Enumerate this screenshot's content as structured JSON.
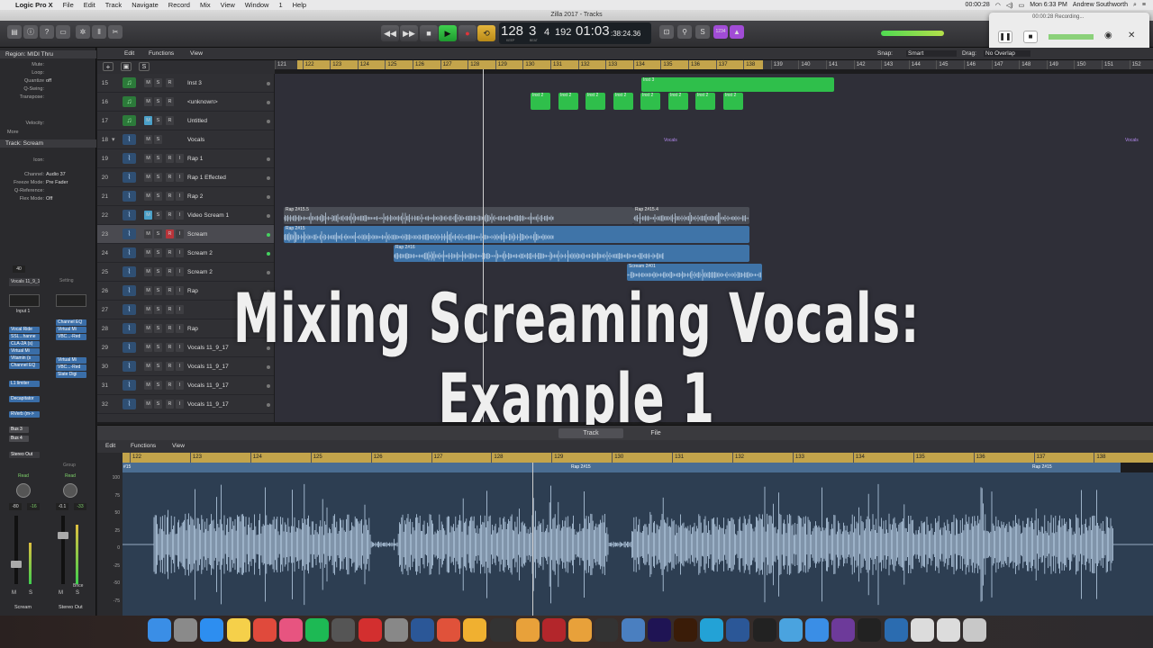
{
  "menubar": {
    "app": "Logic Pro X",
    "items": [
      "File",
      "Edit",
      "Track",
      "Navigate",
      "Record",
      "Mix",
      "View",
      "Window",
      "1",
      "Help"
    ],
    "clock_rec": "00:00:28",
    "datetime": "Mon 6:33 PM",
    "user": "Andrew Southworth"
  },
  "window": {
    "title": "Zilla 2017 - Tracks"
  },
  "lcd": {
    "tempo": "128",
    "bar": "3",
    "beat": "4",
    "div": "192",
    "time": "01:03",
    "smpte": ":38:24.36",
    "key": "1234",
    "tempo_caption": "KEEP",
    "beat_caption": "BEAT"
  },
  "recorder": {
    "time_label": "00:00:28 Recording..."
  },
  "inspector": {
    "region_label": "Region:",
    "region_value": "MIDI Thru",
    "params": [
      {
        "k": "Mute:",
        "v": ""
      },
      {
        "k": "Loop:",
        "v": ""
      },
      {
        "k": "Quantize",
        "v": "off"
      },
      {
        "k": "Q-Swing:",
        "v": ""
      },
      {
        "k": "Transpose:",
        "v": ""
      },
      {
        "k": "",
        "v": ""
      },
      {
        "k": "",
        "v": ""
      },
      {
        "k": "Velocity:",
        "v": ""
      }
    ],
    "more": "More",
    "track_label": "Track:",
    "track_value": "Scream",
    "track_params": [
      {
        "k": "Icon:",
        "v": ""
      },
      {
        "k": "Channel:",
        "v": "Audio 37"
      },
      {
        "k": "Freeze Mode:",
        "v": "Pre Fader"
      },
      {
        "k": "Q-Reference:",
        "v": ""
      },
      {
        "k": "Flex Mode:",
        "v": "Off"
      }
    ],
    "strip1": {
      "name": "Vocals 11_9_17",
      "input": "Input 1",
      "plugins": [
        "Vocal Ride",
        "SSL...hanne",
        "CLA-2A (s)",
        "Virtual Mi",
        "Vitamin (s",
        "Channel EQ"
      ],
      "extra": [
        "L1 limiter",
        "Decapitator",
        "RVerb (m->"
      ],
      "sends": [
        "Bus 3",
        "Bus 4"
      ],
      "output": "Stereo Out",
      "read": "Read",
      "vol": "-80",
      "pk": "-16",
      "label": "Scream",
      "gain": "40"
    },
    "strip2": {
      "setting": "Setting",
      "plugins": [
        "Channel EQ",
        "Virtual Mi",
        "VBC...-Red"
      ],
      "extra": [
        "Virtual Mi",
        "VBC...-Red",
        "Slate Digi"
      ],
      "group": "Group",
      "read": "Read",
      "vol": "-0.1",
      "pk": "-33",
      "bnce": "Bnce",
      "label": "Stereo Out"
    }
  },
  "arrange_menu": {
    "edit": "Edit",
    "functions": "Functions",
    "view": "View",
    "snap_label": "Snap:",
    "snap": "Smart",
    "drag_label": "Drag:",
    "drag": "No Overlap"
  },
  "ruler": [
    "121",
    "122",
    "123",
    "124",
    "125",
    "126",
    "127",
    "128",
    "129",
    "130",
    "131",
    "132",
    "133",
    "134",
    "135",
    "136",
    "137",
    "138",
    "139",
    "140",
    "141",
    "142",
    "143",
    "144",
    "145",
    "146",
    "147",
    "148",
    "149",
    "150",
    "151",
    "152"
  ],
  "tracks": [
    {
      "num": "15",
      "name": "Inst 3",
      "type": "midi",
      "r": false
    },
    {
      "num": "16",
      "name": "<unknown>",
      "type": "midi",
      "r": false
    },
    {
      "num": "17",
      "name": "Untitled",
      "type": "midi",
      "r": false
    },
    {
      "num": "18",
      "name": "Vocals",
      "type": "folder",
      "r": false
    },
    {
      "num": "19",
      "name": "Rap 1",
      "type": "audio",
      "r": true
    },
    {
      "num": "20",
      "name": "Rap 1 Effected",
      "type": "audio",
      "r": true
    },
    {
      "num": "21",
      "name": "Rap 2",
      "type": "audio",
      "r": true
    },
    {
      "num": "22",
      "name": "Video Scream 1",
      "type": "audio",
      "r": true
    },
    {
      "num": "23",
      "name": "Scream",
      "type": "audio",
      "r": true
    },
    {
      "num": "24",
      "name": "Scream 2",
      "type": "audio",
      "r": true
    },
    {
      "num": "25",
      "name": "Scream 2",
      "type": "audio",
      "r": true
    },
    {
      "num": "26",
      "name": "Rap",
      "type": "audio",
      "r": true
    },
    {
      "num": "27",
      "name": "",
      "type": "audio",
      "r": true
    },
    {
      "num": "28",
      "name": "Rap",
      "type": "audio",
      "r": true
    },
    {
      "num": "29",
      "name": "Vocals 11_9_17",
      "type": "audio",
      "r": true
    },
    {
      "num": "30",
      "name": "Vocals 11_9_17",
      "type": "audio",
      "r": true
    },
    {
      "num": "31",
      "name": "Vocals 11_9_17",
      "type": "audio",
      "r": true
    },
    {
      "num": "32",
      "name": "Vocals 11_9_17",
      "type": "audio",
      "r": true
    }
  ],
  "regions": {
    "inst3_top": "Inst 3",
    "inst2": "Inst 2",
    "vocals": "Vocals",
    "rap2_15_5": "Rap 2#15.5",
    "rap2_15_4": "Rap 2#15.4",
    "rap2_15": "Rap 2#15",
    "rap2_16": "Rap 2#16",
    "scream2_01": "Scream 2#01"
  },
  "overlay_title": "Mixing Screaming Vocals: Example 1",
  "editor": {
    "tab_track": "Track",
    "tab_file": "File",
    "edit": "Edit",
    "functions": "Functions",
    "view": "View",
    "ruler": [
      "122",
      "123",
      "124",
      "125",
      "126",
      "127",
      "128",
      "129",
      "130",
      "131",
      "132",
      "133",
      "134",
      "135",
      "136",
      "137",
      "138"
    ],
    "region1": "Rap 2#15",
    "region2": "Rap 2#15",
    "region0": "#15",
    "scale": [
      "100",
      "75",
      "50",
      "25",
      "0",
      "-25",
      "-50",
      "-75",
      "-100"
    ]
  },
  "dock": {
    "items": [
      "Finder",
      "Launchpad",
      "App Store",
      "Notes",
      "Chrome",
      "iTunes",
      "Spotify",
      "Gear",
      "LastPass",
      "Settings",
      "Word",
      "Paw",
      "Transmit",
      "Logic",
      "Pages",
      "FileZilla",
      "Sublime",
      "Logic Pro",
      "Preview",
      "Ae",
      "Ai",
      "C",
      "Xcode",
      "iZotope",
      "Finder2",
      "Safari",
      "Mic",
      "Piano",
      "Terminal",
      "Folder",
      "Folder2",
      "Trash"
    ]
  },
  "colors": {
    "midi_region": "#2fbf4b",
    "audio_region": "#3f74a8",
    "cycle": "#c3a44b",
    "folder_region": "#9a6fd6"
  }
}
